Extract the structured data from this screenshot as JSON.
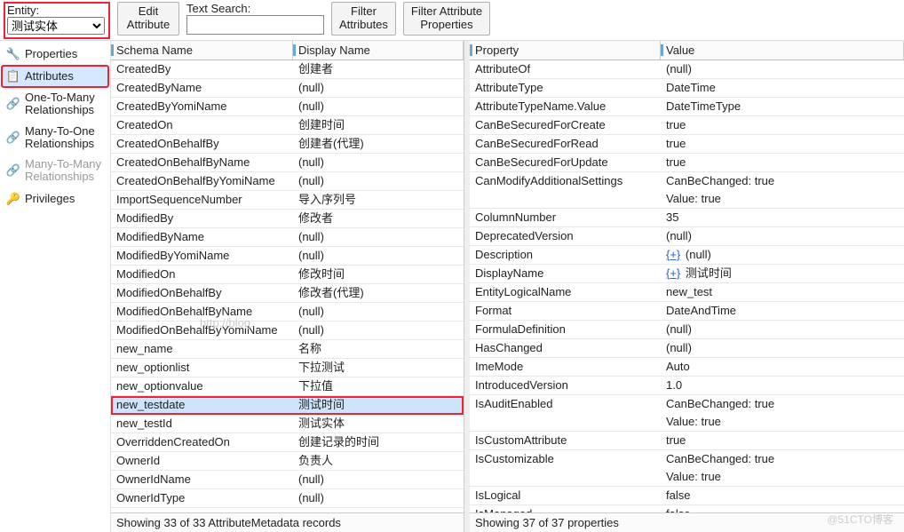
{
  "top": {
    "entity_label": "Entity:",
    "entity_value": "测试实体",
    "edit_attribute": "Edit\nAttribute",
    "text_search_label": "Text Search:",
    "text_search_value": "",
    "filter_attributes": "Filter\nAttributes",
    "filter_attribute_properties": "Filter Attribute\nProperties"
  },
  "sidebar": {
    "items": [
      {
        "label": "Properties",
        "icon": "properties-icon"
      },
      {
        "label": "Attributes",
        "icon": "attributes-icon",
        "selected": true,
        "highlight": true
      },
      {
        "label": "One-To-Many Relationships",
        "icon": "one-to-many-icon"
      },
      {
        "label": "Many-To-One Relationships",
        "icon": "many-to-one-icon"
      },
      {
        "label": "Many-To-Many Relationships",
        "icon": "many-to-many-icon",
        "disabled": true
      },
      {
        "label": "Privileges",
        "icon": "privileges-icon"
      }
    ]
  },
  "attributes": {
    "headers": [
      "Schema Name",
      "Display Name"
    ],
    "rows": [
      {
        "schema": "CreatedBy",
        "display": "创建者"
      },
      {
        "schema": "CreatedByName",
        "display": "(null)"
      },
      {
        "schema": "CreatedByYomiName",
        "display": "(null)"
      },
      {
        "schema": "CreatedOn",
        "display": "创建时间"
      },
      {
        "schema": "CreatedOnBehalfBy",
        "display": "创建者(代理)"
      },
      {
        "schema": "CreatedOnBehalfByName",
        "display": "(null)"
      },
      {
        "schema": "CreatedOnBehalfByYomiName",
        "display": "(null)"
      },
      {
        "schema": "ImportSequenceNumber",
        "display": "导入序列号"
      },
      {
        "schema": "ModifiedBy",
        "display": "修改者"
      },
      {
        "schema": "ModifiedByName",
        "display": "(null)"
      },
      {
        "schema": "ModifiedByYomiName",
        "display": "(null)"
      },
      {
        "schema": "ModifiedOn",
        "display": "修改时间"
      },
      {
        "schema": "ModifiedOnBehalfBy",
        "display": "修改者(代理)"
      },
      {
        "schema": "ModifiedOnBehalfByName",
        "display": "(null)"
      },
      {
        "schema": "ModifiedOnBehalfByYomiName",
        "display": "(null)"
      },
      {
        "schema": "new_name",
        "display": "名称"
      },
      {
        "schema": "new_optionlist",
        "display": "下拉测试"
      },
      {
        "schema": "new_optionvalue",
        "display": "下拉值"
      },
      {
        "schema": "new_testdate",
        "display": "测试时间",
        "selected": true,
        "highlight": true
      },
      {
        "schema": "new_testId",
        "display": "测试实体"
      },
      {
        "schema": "OverriddenCreatedOn",
        "display": "创建记录的时间"
      },
      {
        "schema": "OwnerId",
        "display": "负责人"
      },
      {
        "schema": "OwnerIdName",
        "display": "(null)"
      },
      {
        "schema": "OwnerIdType",
        "display": "(null)"
      }
    ],
    "status": "Showing 33 of 33 AttributeMetadata records"
  },
  "properties": {
    "headers": [
      "Property",
      "Value"
    ],
    "rows": [
      {
        "prop": "AttributeOf",
        "value": "(null)"
      },
      {
        "prop": "AttributeType",
        "value": "DateTime"
      },
      {
        "prop": "AttributeTypeName.Value",
        "value": "DateTimeType"
      },
      {
        "prop": "CanBeSecuredForCreate",
        "value": "true"
      },
      {
        "prop": "CanBeSecuredForRead",
        "value": "true"
      },
      {
        "prop": "CanBeSecuredForUpdate",
        "value": "true"
      },
      {
        "prop": "CanModifyAdditionalSettings",
        "value": "CanBeChanged: true\nValue: true"
      },
      {
        "prop": "ColumnNumber",
        "value": "35"
      },
      {
        "prop": "DeprecatedVersion",
        "value": "(null)"
      },
      {
        "prop": "Description",
        "value": "(null)",
        "expand": true
      },
      {
        "prop": "DisplayName",
        "value": "测试时间",
        "expand": true
      },
      {
        "prop": "EntityLogicalName",
        "value": "new_test"
      },
      {
        "prop": "Format",
        "value": "DateAndTime"
      },
      {
        "prop": "FormulaDefinition",
        "value": "(null)"
      },
      {
        "prop": "HasChanged",
        "value": "(null)"
      },
      {
        "prop": "ImeMode",
        "value": "Auto"
      },
      {
        "prop": "IntroducedVersion",
        "value": "1.0"
      },
      {
        "prop": "IsAuditEnabled",
        "value": "CanBeChanged: true\nValue: true"
      },
      {
        "prop": "IsCustomAttribute",
        "value": "true"
      },
      {
        "prop": "IsCustomizable",
        "value": "CanBeChanged: true\nValue: true"
      },
      {
        "prop": "IsLogical",
        "value": "false"
      },
      {
        "prop": "IsManaged",
        "value": "false"
      }
    ],
    "status": "Showing 37 of 37 properties"
  },
  "expand_glyph": "{+}",
  "watermark_url": "http://blog.",
  "watermark_footer": "@51CTO博客"
}
